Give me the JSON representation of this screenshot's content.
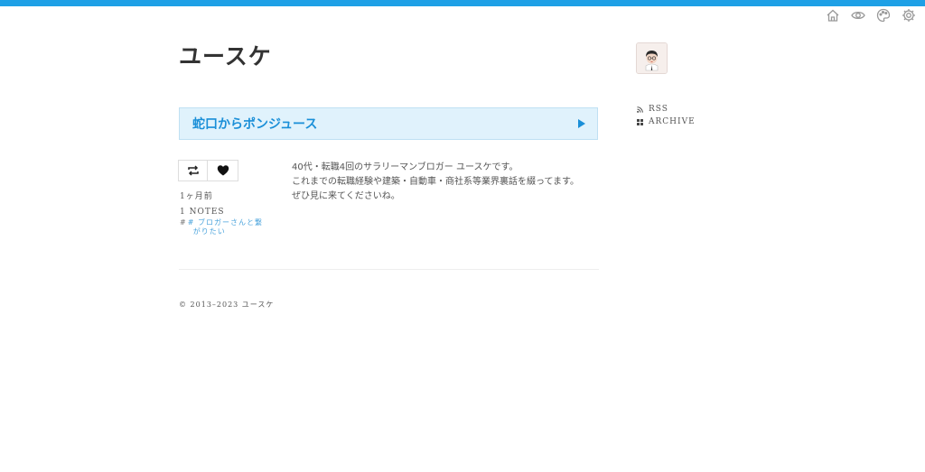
{
  "site": {
    "title": "ユースケ"
  },
  "topbar": {
    "accent_color": "#1ea0e6",
    "icons": [
      "home-icon",
      "eye-icon",
      "palette-icon",
      "gear-icon"
    ]
  },
  "sidebar": {
    "links": [
      {
        "label": "RSS",
        "icon": "rss-icon"
      },
      {
        "label": "ARCHIVE",
        "icon": "grid-icon"
      }
    ]
  },
  "banner": {
    "title": "蛇口からポンジュース",
    "background_color": "#e0f2fc",
    "text_color": "#1a8fd8"
  },
  "post": {
    "actions": [
      "reblog-icon",
      "heart-icon"
    ],
    "date": "1ヶ月前",
    "notes": "1 NOTES",
    "tag_line1": "# ブロガーさんと繋",
    "tag_line2": "がりたい",
    "tag_hash": "#",
    "body": [
      "40代・転職4回のサラリーマンブロガー ユースケです。",
      "これまでの転職経験や建築・自動車・商社系等業界裏話を綴ってます。",
      "ぜひ見に来てくださいね。"
    ]
  },
  "footer": {
    "text": "© 2013–2023 ユースケ"
  }
}
